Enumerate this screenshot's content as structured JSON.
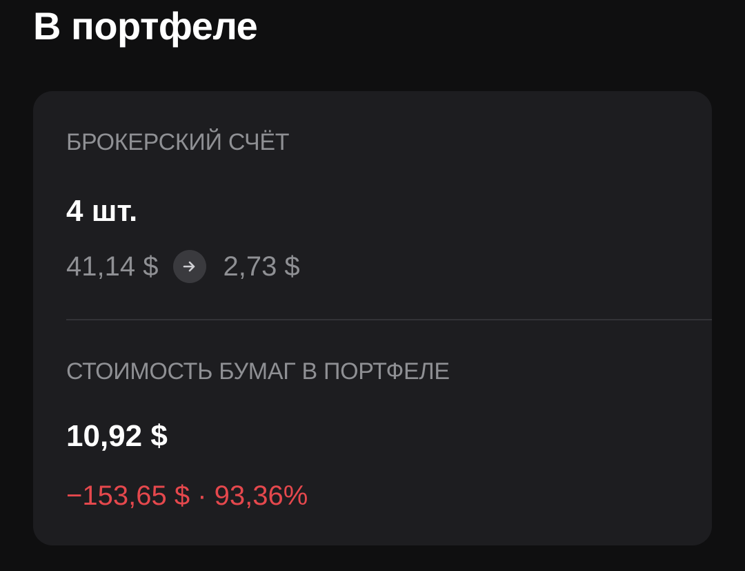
{
  "header": {
    "title": "В портфеле"
  },
  "brokerage": {
    "label": "БРОКЕРСКИЙ СЧЁТ",
    "quantity": "4 шт.",
    "price_from": "41,14 $",
    "arrow_icon": "arrow-right-icon",
    "price_to": "2,73 $"
  },
  "holdings": {
    "label": "СТОИМОСТЬ БУМАГ В ПОРТФЕЛЕ",
    "value": "10,92 $",
    "change_amount": "−153,65 $",
    "separator": "·",
    "change_percent": "93,36%"
  },
  "colors": {
    "background": "#0f0f10",
    "card": "#1d1d20",
    "muted_text": "#8f9094",
    "negative": "#e5484d"
  }
}
